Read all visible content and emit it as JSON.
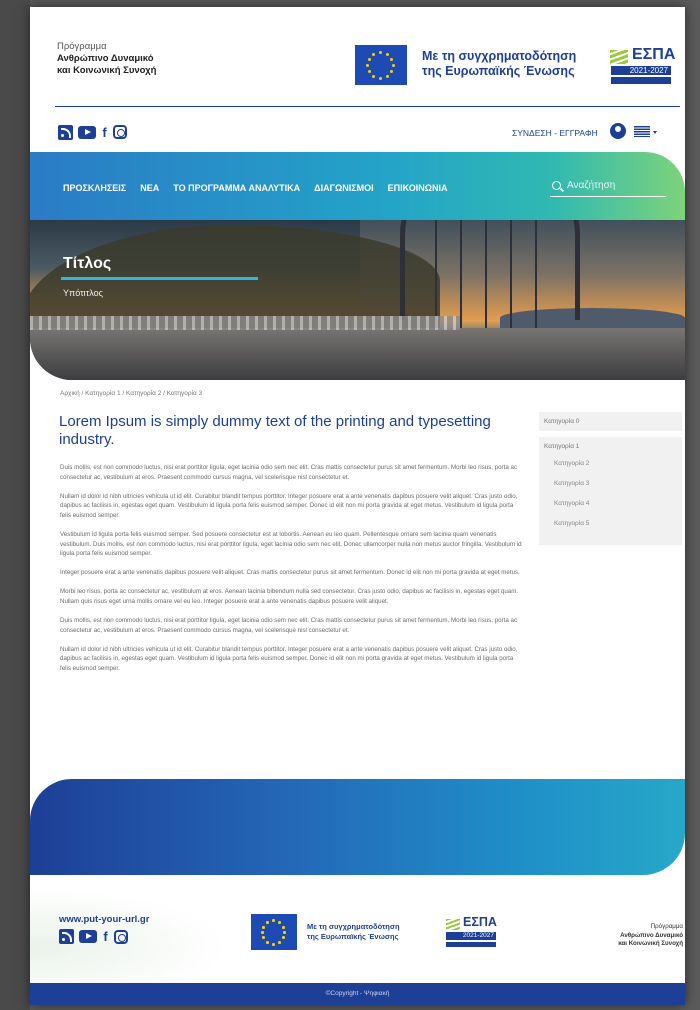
{
  "program": {
    "line1": "Πρόγραμμα",
    "line2": "Ανθρώπινο Δυναμικό",
    "line3": "και Κοινωνική Συνοχή"
  },
  "cofunding": {
    "line1": "Με τη συγχρηματοδότηση",
    "line2": "της Ευρωπαϊκής Ένωσης"
  },
  "espa": {
    "word": "ΕΣΠΑ",
    "years": "2021-2027"
  },
  "topbar": {
    "login": "ΣΥΝΔΕΣΗ - ΕΓΓΡΑΦΗ"
  },
  "nav": {
    "items": [
      "ΠΡΟΣΚΛΗΣΕΙΣ",
      "ΝΕΑ",
      "ΤΟ ΠΡΟΓΡΑΜΜΑ ΑΝΑΛΥΤΙΚΑ",
      "ΔΙΑΓΩΝΙΣΜΟΙ",
      "ΕΠΙΚΟΙΝΩΝΙΑ"
    ],
    "search_placeholder": "Αναζήτηση"
  },
  "hero": {
    "title": "Τίτλος",
    "subtitle": "Υπότιτλος"
  },
  "breadcrumb": "Αρχική / Κατηγορία 1 / Κατηγορία 2 / Κατηγορία 3",
  "article": {
    "heading": "Lorem Ipsum is simply dummy text of the printing and typesetting industry.",
    "paragraphs": [
      "Duis mollis, est non commodo luctus, nisi erat porttitor ligula, eget lacinia odio sem nec elit. Cras mattis consectetur purus sit amet fermentum. Morbi leo risus, porta ac consectetur ac, vestibulum at eros. Praesent commodo cursus magna, vel scelerisque nisl consectetur et.",
      "Nullam id dolor id nibh ultricies vehicula ut id elit. Curabitur blandit tempus porttitor. Integer posuere erat a ante venenatis dapibus posuere velit aliquet. Cras justo odio, dapibus ac facilisis in, egestas eget quam. Vestibulum id ligula porta felis euismod semper. Donec id elit non mi porta gravida at eget metus. Vestibulum id ligula porta felis euismod semper.",
      "Vestibulum id ligula porta felis euismod semper. Sed posuere consectetur est at lobortis. Aenean eu leo quam. Pellentesque ornare sem lacinia quam venenatis vestibulum. Duis mollis, est non commodo luctus, nisi erat porttitor ligula, eget lacinia odio sem nec elit. Donec ullamcorper nulla non metus auctor fringilla. Vestibulum id ligula porta felis euismod semper.",
      "Integer posuere erat a ante venenatis dapibus posuere velit aliquet. Cras mattis consectetur purus sit amet fermentum. Donec id elit non mi porta gravida at eget metus.",
      "Morbi leo risus, porta ac consectetur ac, vestibulum at eros. Aenean lacinia bibendum nulla sed consectetur. Cras justo odio, dapibus ac facilisis in, egestas eget quam. Nullam quis risus eget urna mollis ornare vel eu leo. Integer posuere erat a ante venenatis dapibus posuere velit aliquet.",
      "Duis mollis, est non commodo luctus, nisi erat porttitor ligula, eget lacinia odio sem nec elit. Cras mattis consectetur purus sit amet fermentum. Morbi leo risus, porta ac consectetur ac, vestibulum at eros. Praesent commodo cursus magna, vel scelerisque nisl consectetur et.",
      "Nullam id dolor id nibh ultricies vehicula ut id elit. Curabitur blandit tempus porttitor. Integer posuere erat a ante venenatis dapibus posuere velit aliquet. Cras justo odio, dapibus ac facilisis in, egestas eget quam. Vestibulum id ligula porta felis euismod semper. Donec id elit non mi porta gravida at eget metus. Vestibulum id ligula porta felis euismod semper."
    ]
  },
  "sidebar": {
    "item0": "Κατηγορία 0",
    "group_head": "Κατηγορία 1",
    "subitems": [
      "Κατηγορία 2",
      "Κατηγορία 3",
      "Κατηγορία 4",
      "Κατηγορία 5"
    ]
  },
  "footer": {
    "url": "www.put-your-url.gr",
    "copyright": "©Copyright - Ψηφιακή"
  },
  "colors": {
    "brand_blue": "#1d3f96",
    "accent_cyan": "#2fb6e1",
    "green": "#7dd37a"
  }
}
